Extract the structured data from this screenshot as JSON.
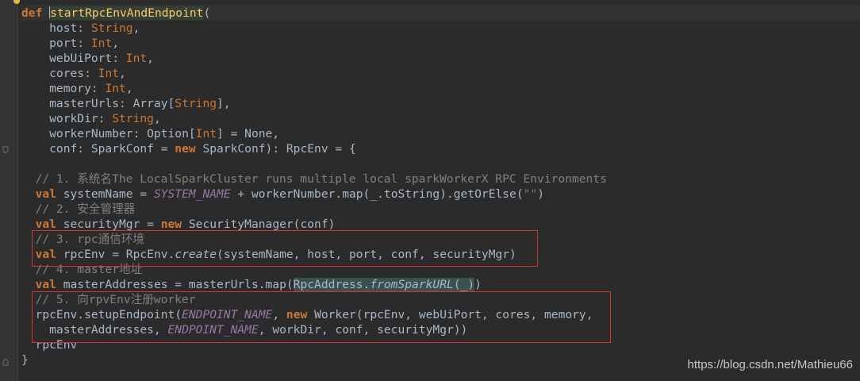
{
  "editor": {
    "lines": [
      [
        [
          "kw",
          "def "
        ],
        [
          "caret",
          ""
        ],
        [
          "fn",
          "startRpcEnvAndEndpoint"
        ],
        [
          "p",
          "("
        ]
      ],
      [
        [
          "p",
          "    host: "
        ],
        [
          "ty",
          "String"
        ],
        [
          "p",
          ","
        ]
      ],
      [
        [
          "p",
          "    port: "
        ],
        [
          "ty",
          "Int"
        ],
        [
          "p",
          ","
        ]
      ],
      [
        [
          "p",
          "    webUiPort: "
        ],
        [
          "ty",
          "Int"
        ],
        [
          "p",
          ","
        ]
      ],
      [
        [
          "p",
          "    cores: "
        ],
        [
          "ty",
          "Int"
        ],
        [
          "p",
          ","
        ]
      ],
      [
        [
          "p",
          "    memory: "
        ],
        [
          "ty",
          "Int"
        ],
        [
          "p",
          ","
        ]
      ],
      [
        [
          "p",
          "    masterUrls: Array["
        ],
        [
          "ty",
          "String"
        ],
        [
          "p",
          "],"
        ]
      ],
      [
        [
          "p",
          "    workDir: "
        ],
        [
          "ty",
          "String"
        ],
        [
          "p",
          ","
        ]
      ],
      [
        [
          "p",
          "    workerNumber: Option["
        ],
        [
          "ty",
          "Int"
        ],
        [
          "p",
          "] = None,"
        ]
      ],
      [
        [
          "p",
          "    conf: SparkConf = "
        ],
        [
          "kw",
          "new "
        ],
        [
          "p",
          "SparkConf): RpcEnv = {"
        ]
      ],
      [
        [
          "p",
          ""
        ]
      ],
      [
        [
          "cmt",
          "  // 1. 系统名The LocalSparkCluster runs multiple local sparkWorkerX RPC Environments"
        ]
      ],
      [
        [
          "kw",
          "  val "
        ],
        [
          "p",
          "systemName = "
        ],
        [
          "const",
          "SYSTEM_NAME"
        ],
        [
          "p",
          " + workerNumber.map(_.toString).getOrElse("
        ],
        [
          "str",
          "\"\""
        ],
        [
          "p",
          ")"
        ]
      ],
      [
        [
          "cmt",
          "  // 2. 安全管理器"
        ]
      ],
      [
        [
          "kw",
          "  val "
        ],
        [
          "p",
          "securityMgr = "
        ],
        [
          "kw",
          "new "
        ],
        [
          "p",
          "SecurityManager(conf)"
        ]
      ],
      [
        [
          "cmt",
          "  // 3. rpc通信环境"
        ]
      ],
      [
        [
          "kw",
          "  val "
        ],
        [
          "p",
          "rpcEnv = RpcEnv."
        ],
        [
          "ital",
          "create"
        ],
        [
          "p",
          "(systemName, host, port, conf, securityMgr)"
        ]
      ],
      [
        [
          "cmt",
          "  // 4. master地址"
        ]
      ],
      [
        [
          "kw",
          "  val "
        ],
        [
          "p",
          "masterAddresses = masterUrls.map("
        ],
        [
          "hl",
          "RpcAddress."
        ],
        [
          "hlital",
          "fromSparkURL"
        ],
        [
          "hl",
          "(_)"
        ],
        [
          "p",
          ")"
        ]
      ],
      [
        [
          "cmt",
          "  // 5. 向rpvEnv注册worker"
        ]
      ],
      [
        [
          "p",
          "  rpcEnv.setupEndpoint("
        ],
        [
          "const",
          "ENDPOINT_NAME"
        ],
        [
          "p",
          ", "
        ],
        [
          "kw",
          "new "
        ],
        [
          "p",
          "Worker(rpcEnv, webUiPort, cores, memory,"
        ]
      ],
      [
        [
          "p",
          "    masterAddresses, "
        ],
        [
          "const",
          "ENDPOINT_NAME"
        ],
        [
          "p",
          ", workDir, conf, securityMgr))"
        ]
      ],
      [
        [
          "p",
          "  rpcEnv"
        ]
      ],
      [
        [
          "p",
          "}"
        ]
      ]
    ]
  },
  "watermark": "https://blog.csdn.net/Mathieu66",
  "colors": {
    "background": "#2b2b2b",
    "keyword": "#cc7832",
    "function_name": "#ffc66d",
    "string": "#6a8759",
    "comment": "#808080",
    "constant": "#9876aa",
    "annotation_box": "#d0353a"
  }
}
